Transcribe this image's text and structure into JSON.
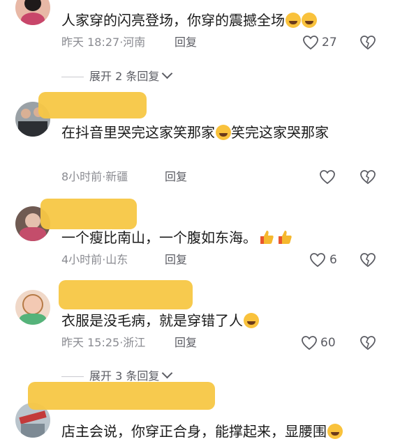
{
  "comments": [
    {
      "text": "人家穿的闪亮登场，你穿的震撼全场",
      "time": "昨天 18:27",
      "location": "河南",
      "reply_label": "回复",
      "likes": "27"
    },
    {
      "text_part1": "在抖音里哭完这家笑那家",
      "text_part2": "笑完这家哭那家",
      "time": "8小时前",
      "location": "新疆",
      "reply_label": "回复"
    },
    {
      "text": "一个瘦比南山，一个腹如东海。",
      "time": "4小时前",
      "location": "山东",
      "reply_label": "回复",
      "likes": "6"
    },
    {
      "text": "衣服是没毛病，就是穿错了人",
      "time": "昨天 15:25",
      "location": "浙江",
      "reply_label": "回复",
      "likes": "60"
    },
    {
      "text": "店主会说，你穿正合身，能撑起来，显腰围"
    }
  ],
  "expanders": [
    {
      "label": "展开 2 条回复"
    },
    {
      "label": "展开 3 条回复"
    }
  ],
  "meta_separator": "·",
  "colors": {
    "blur_overlay": "#f7c745",
    "meta_text": "#8a8b91",
    "main_text": "#1a1a1a"
  }
}
